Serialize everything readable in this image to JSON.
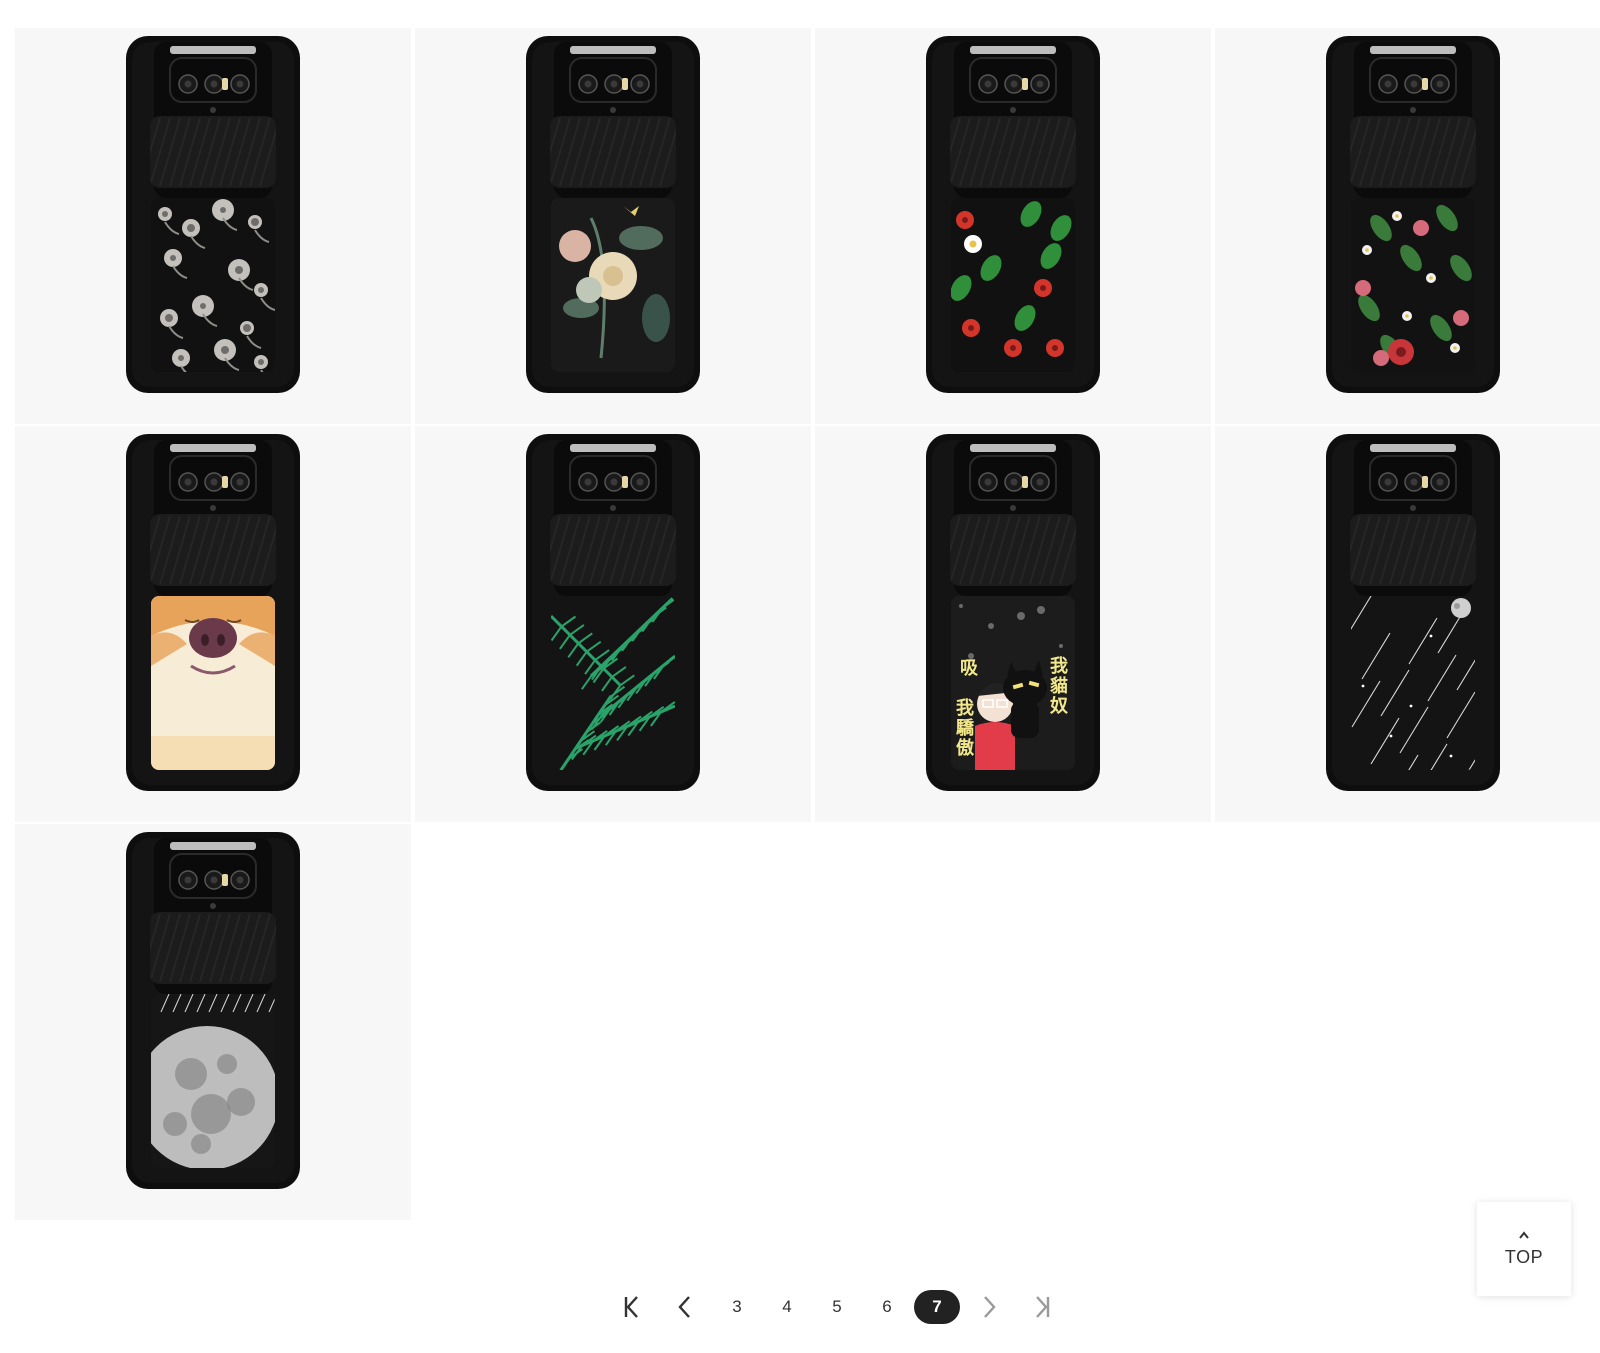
{
  "products": [
    {
      "design": "white-vintage-floral",
      "art": "floral-white",
      "colors": {
        "petal": "#d8d5d0",
        "leaf": "#8f8f8a",
        "bg": "#111111"
      }
    },
    {
      "design": "pastel-rose-bouquet",
      "art": "bouquet",
      "colors": {
        "petal": "#e8d9b8",
        "leaf": "#5f7f6e",
        "bg": "#1a1a1a"
      }
    },
    {
      "design": "red-flowers-strawberry",
      "art": "floral-red",
      "colors": {
        "petal": "#d3352b",
        "leaf": "#2f8f3a",
        "bg": "#111111"
      }
    },
    {
      "design": "red-roses-white-blossoms",
      "art": "roses",
      "colors": {
        "petal": "#c8363a",
        "leaf": "#3a7a3a",
        "bg": "#121212"
      }
    },
    {
      "design": "shiba-dog-nose",
      "art": "shiba",
      "colors": {
        "fur": "#e7a35a",
        "face": "#f7ecd6",
        "nose": "#6b3a4a"
      }
    },
    {
      "design": "green-palm-leaves",
      "art": "palm",
      "colors": {
        "leaf": "#2aa36b",
        "bg": "#141414"
      }
    },
    {
      "design": "cat-lover-cartoon",
      "art": "cartoon",
      "colors": {
        "text": "#f2e88a",
        "shirt": "#e23b4a",
        "bg": "#1c1c1c"
      },
      "lines": [
        "我",
        "貓",
        "奴"
      ],
      "lines2": [
        "我",
        "驕",
        "傲"
      ],
      "side": "吸"
    },
    {
      "design": "meteor-shower-night",
      "art": "meteor",
      "colors": {
        "line": "#d9d9d9",
        "bg": "#141414"
      }
    },
    {
      "design": "full-moon-rain",
      "art": "moon",
      "colors": {
        "moon": "#bdbdbd",
        "dark": "#7a7a7a",
        "bg": "#161616"
      }
    }
  ],
  "pagination": {
    "pages": [
      "3",
      "4",
      "5",
      "6",
      "7"
    ],
    "current": "7",
    "colors": {
      "active_bg": "#222222",
      "active_text": "#ffffff"
    }
  },
  "back_to_top": {
    "label": "TOP"
  }
}
